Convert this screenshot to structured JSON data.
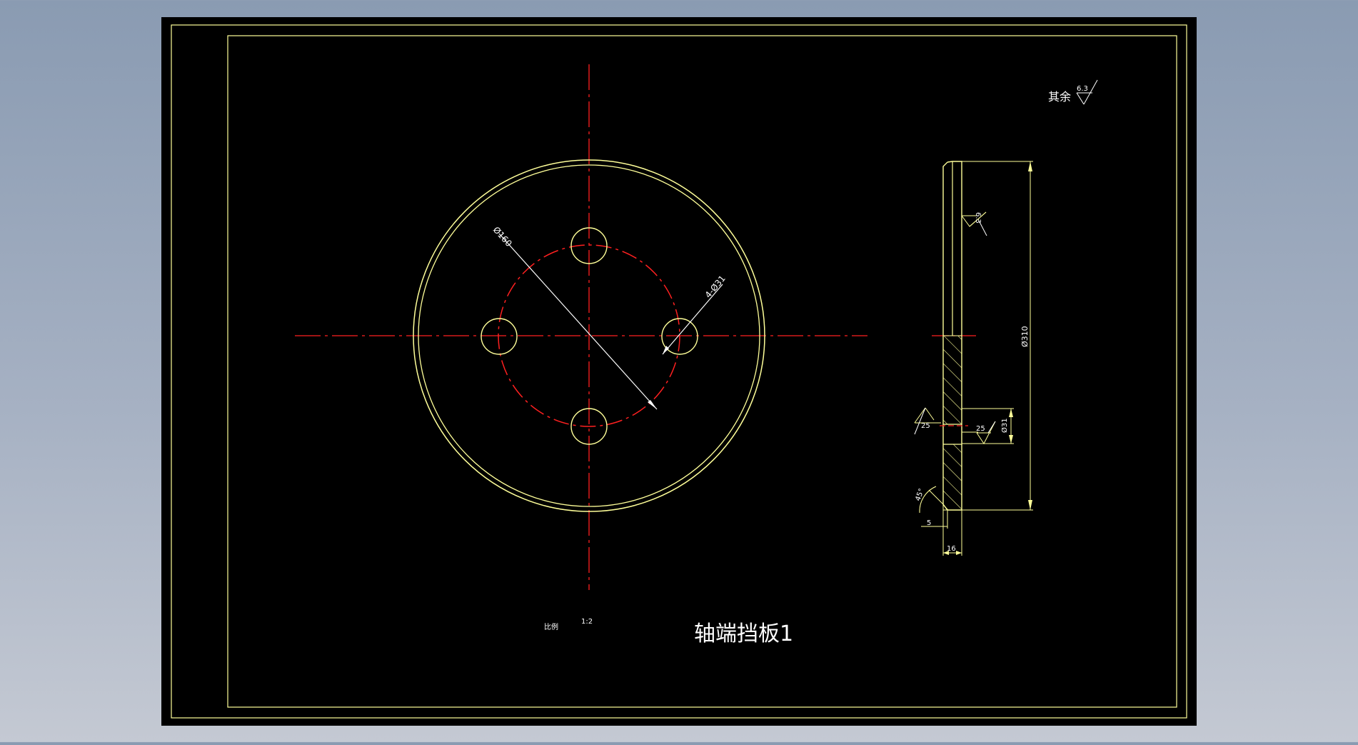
{
  "drawing": {
    "title": "轴端挡板1",
    "scale_label": "比例",
    "scale_value": "1:2",
    "roughness_note": {
      "label": "其余",
      "value": "6.3"
    },
    "front_view": {
      "bolt_circle_dim": "Ø160",
      "holes_dim": "4-Ø31"
    },
    "side_view": {
      "roughness_face": "6.3",
      "overall_dim": "Ø310",
      "hole_dim": "Ø31",
      "roughness_hole_left": "25",
      "roughness_hole_right": "25",
      "chamfer_angle": "45°",
      "chamfer_size": "5",
      "thickness": "16"
    }
  },
  "colors": {
    "background": "#000000",
    "outline": "#ffff99",
    "centerline": "#ff2020",
    "dimension": "#ffffff",
    "hatch": "#ffff99"
  }
}
